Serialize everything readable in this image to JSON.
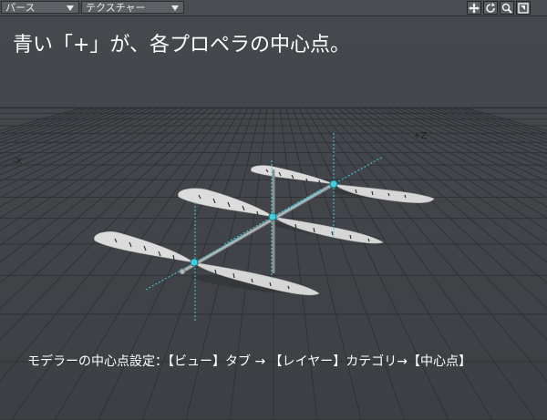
{
  "toolbar": {
    "view_mode": "パース",
    "shading_mode": "テクスチャー",
    "buttons": [
      {
        "name": "move-view-icon"
      },
      {
        "name": "rotate-view-icon"
      },
      {
        "name": "zoom-view-icon"
      },
      {
        "name": "maximize-viewport-icon"
      }
    ]
  },
  "viewport": {
    "title": "青い「+」が、各プロペラの中心点。",
    "axis_x_label": "-X",
    "axis_z_label": "+Z",
    "caption": "モデラーの中心点設定：【ビュー】タブ → 【レイヤー】カテゴリ→【中心点】"
  },
  "colors": {
    "background": "#44474b",
    "grid": "#2f3236",
    "pivot": "#3fd0df",
    "blade": "#d9d9d9"
  }
}
